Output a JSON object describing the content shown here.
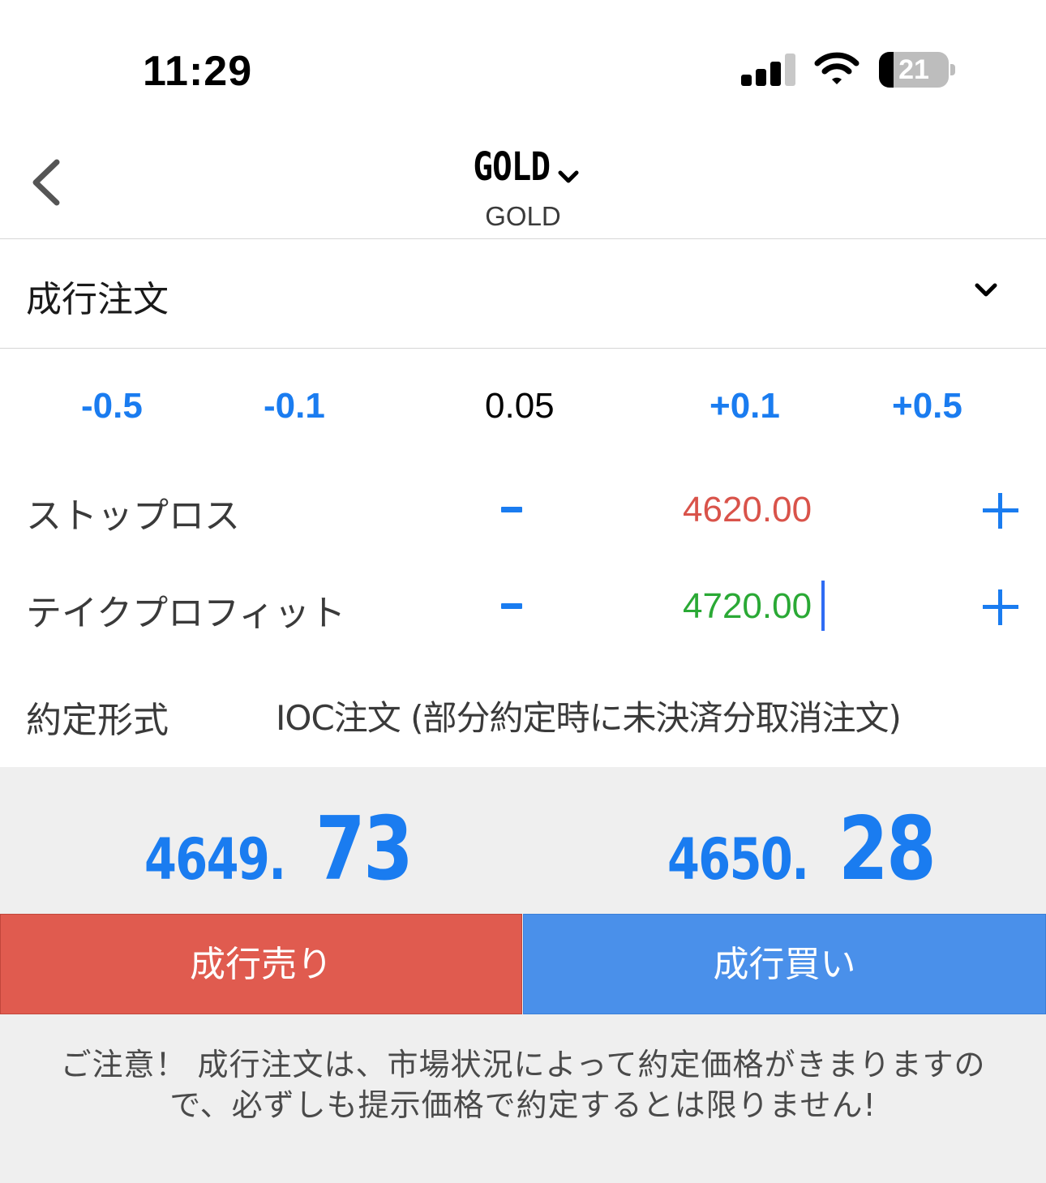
{
  "status_bar": {
    "time": "11:29",
    "battery_percent": "21",
    "battery_level": 0.21,
    "icons": [
      "cellular-signal-icon",
      "wifi-icon",
      "battery-icon"
    ]
  },
  "header": {
    "title": "GOLD",
    "subtitle": "GOLD",
    "back_icon": "chevron-left-icon",
    "title_dropdown_icon": "chevron-down-icon"
  },
  "order_type": {
    "label": "成行注文",
    "dropdown_icon": "chevron-down-icon"
  },
  "volume_stepper": {
    "minus_large": "-0.5",
    "minus_small": "-0.1",
    "current": "0.05",
    "plus_small": "+0.1",
    "plus_large": "+0.5"
  },
  "stop_loss": {
    "label": "ストップロス",
    "value": "4620.00",
    "value_color": "#d9534a"
  },
  "take_profit": {
    "label": "テイクプロフィット",
    "value": "4720.00",
    "value_color": "#2aa935"
  },
  "execution": {
    "label": "約定形式",
    "value": "IOC注文 (部分約定時に未決済分取消注文)"
  },
  "quotes": {
    "sell_price_main": "4649.",
    "sell_price_pips": "73",
    "buy_price_main": "4650.",
    "buy_price_pips": "28"
  },
  "actions": {
    "sell_label": "成行売り",
    "buy_label": "成行買い"
  },
  "notice": {
    "line1": "ご注意！ 成行注文は、市場状況によって約定価格がきまりますの",
    "line2": "で、必ずしも提示価格で約定するとは限りません!"
  },
  "colors": {
    "accent_blue": "#1a7cf0",
    "sell_red": "#e05b4f",
    "buy_blue": "#4a90ea",
    "band_gray": "#efefef"
  }
}
